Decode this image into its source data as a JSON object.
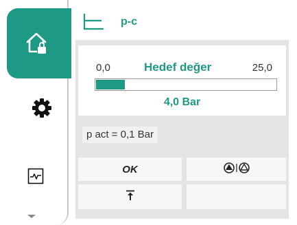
{
  "header": {
    "mode_label": "p-c",
    "mode_icon": "constant-pressure-curve-icon"
  },
  "sidebar": {
    "items": [
      {
        "name": "home",
        "icon": "home-lock-icon",
        "active": true
      },
      {
        "name": "settings",
        "icon": "gear-icon",
        "active": false
      },
      {
        "name": "diagnostics",
        "icon": "chart-icon",
        "active": false
      }
    ],
    "scroll_icon": "chevron-down-icon"
  },
  "setpoint": {
    "title": "Hedef değer",
    "min": "0,0",
    "max": "25,0",
    "value_label": "4,0 Bar",
    "fill_fraction": 0.16
  },
  "actual": {
    "label": "p act = 0,1",
    "unit": "Bar"
  },
  "buttons": {
    "ok_label": "OK",
    "mode_icon": "pump-single-twin-icon",
    "upload_icon": "upload-icon"
  },
  "colors": {
    "accent": "#1e9a84",
    "panel": "#e4e4e4",
    "button": "#f7f7f7"
  }
}
